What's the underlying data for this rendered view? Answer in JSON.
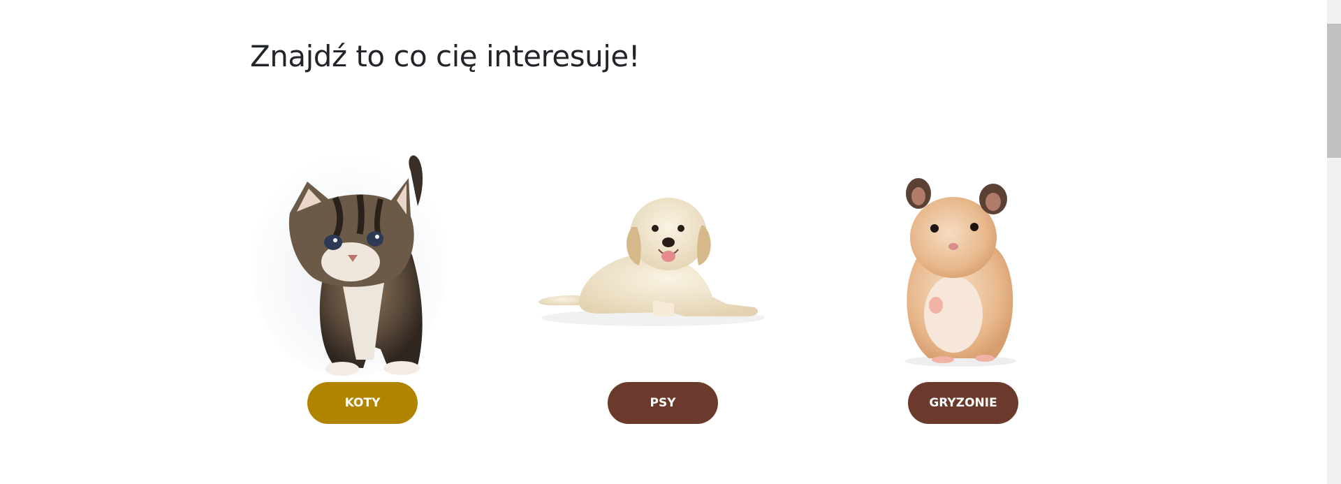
{
  "heading": "Znajdź to co cię interesuje!",
  "colors": {
    "active_button": "#b18400",
    "default_button": "#6b3a2c",
    "heading_text": "#212529"
  },
  "categories": [
    {
      "label": "KOTY",
      "image": "kitten-photo",
      "active": true
    },
    {
      "label": "PSY",
      "image": "puppy-photo",
      "active": false
    },
    {
      "label": "GRYZONIE",
      "image": "hamster-photo",
      "active": false
    }
  ]
}
